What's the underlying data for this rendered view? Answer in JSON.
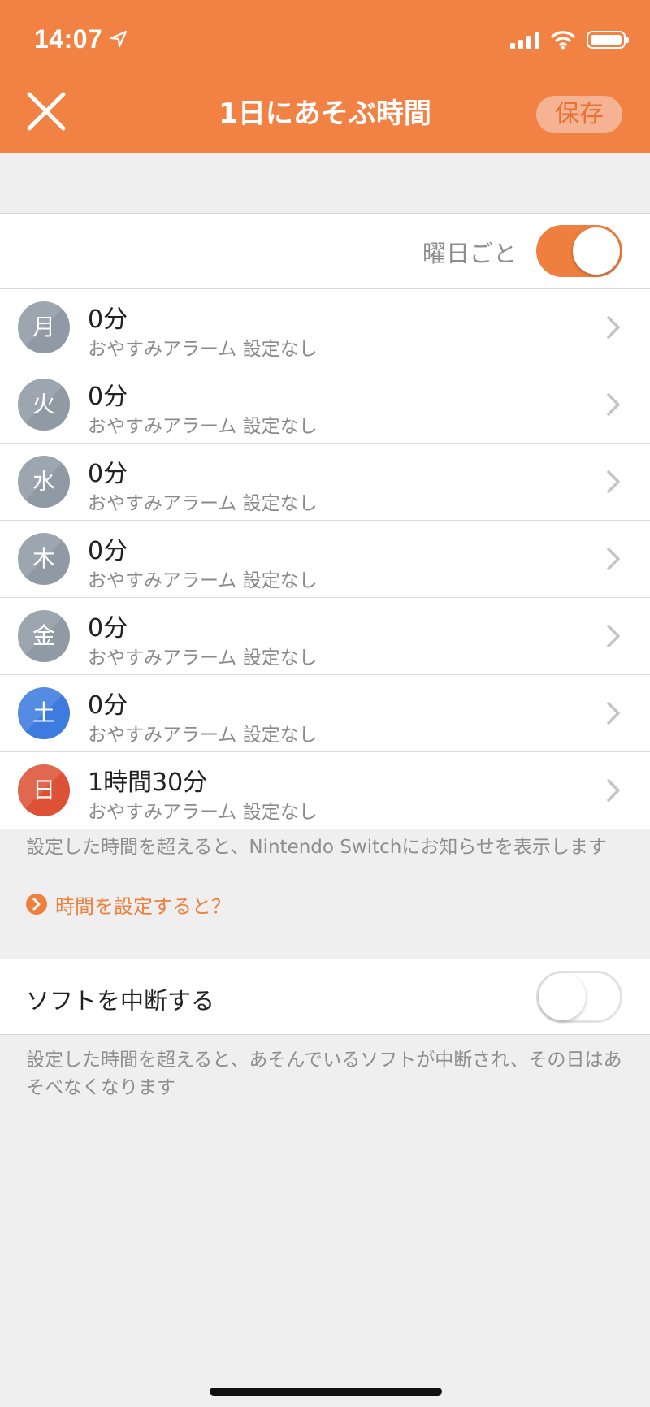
{
  "status_bar": {
    "time": "14:07"
  },
  "header": {
    "title": "1日にあそぶ時間",
    "save_label": "保存"
  },
  "weekday_toggle": {
    "label": "曜日ごと",
    "on": true
  },
  "days": [
    {
      "day": "月",
      "time": "0分",
      "alarm": "おやすみアラーム 設定なし",
      "color": "#8f9aa5"
    },
    {
      "day": "火",
      "time": "0分",
      "alarm": "おやすみアラーム 設定なし",
      "color": "#8f9aa5"
    },
    {
      "day": "水",
      "time": "0分",
      "alarm": "おやすみアラーム 設定なし",
      "color": "#8f9aa5"
    },
    {
      "day": "木",
      "time": "0分",
      "alarm": "おやすみアラーム 設定なし",
      "color": "#8f9aa5"
    },
    {
      "day": "金",
      "time": "0分",
      "alarm": "おやすみアラーム 設定なし",
      "color": "#8f9aa5"
    },
    {
      "day": "土",
      "time": "0分",
      "alarm": "おやすみアラーム 設定なし",
      "color": "#3d7bdf"
    },
    {
      "day": "日",
      "time": "1時間30分",
      "alarm": "おやすみアラーム 設定なし",
      "color": "#dd5237"
    }
  ],
  "notice": {
    "text": "設定した時間を超えると、Nintendo Switchにお知らせを表示します",
    "link": "時間を設定すると？"
  },
  "interrupt": {
    "label": "ソフトを中断する",
    "on": false,
    "note": "設定した時間を超えると、あそんでいるソフトが中断され、その日はあそべなくなります"
  },
  "colors": {
    "accent": "#f28244",
    "save_text": "#e9702f",
    "background": "#efefef"
  }
}
